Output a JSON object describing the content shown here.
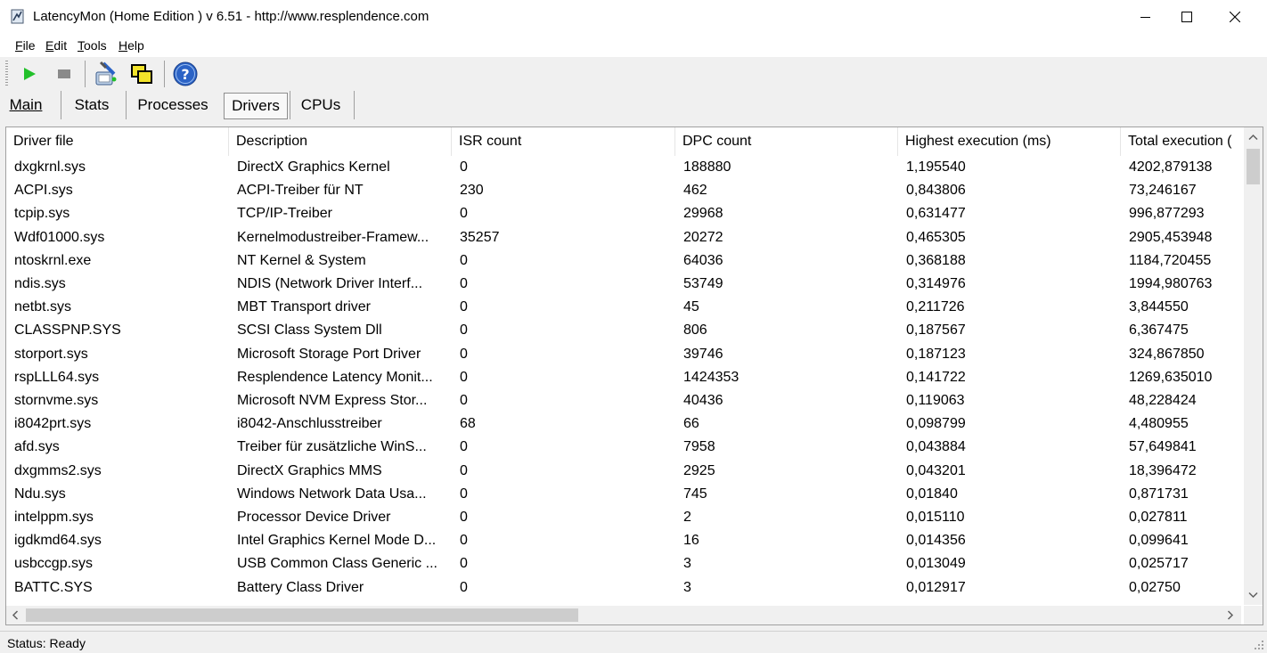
{
  "window": {
    "title": "LatencyMon  (Home Edition )  v 6.51 - http://www.resplendence.com"
  },
  "menu": [
    {
      "key": "F",
      "rest": "ile"
    },
    {
      "key": "E",
      "rest": "dit"
    },
    {
      "key": "T",
      "rest": "ools"
    },
    {
      "key": "H",
      "rest": "elp"
    }
  ],
  "toolbar": {
    "icons": [
      "start-play-icon",
      "stop-icon",
      "analyze-tools-icon",
      "copy-windows-icon",
      "help-question-icon"
    ],
    "colors": {
      "play": "#22c02a",
      "help": "#2b63c6"
    }
  },
  "tabs": [
    {
      "label": "Main",
      "active": false
    },
    {
      "label": "Stats",
      "active": false
    },
    {
      "label": "Processes",
      "active": false
    },
    {
      "label": "Drivers",
      "active": true
    },
    {
      "label": "CPUs",
      "active": false
    }
  ],
  "table": {
    "columns": [
      "Driver file",
      "Description",
      "ISR count",
      "DPC count",
      "Highest execution (ms)",
      "Total execution ("
    ],
    "rows": [
      [
        "dxgkrnl.sys",
        "DirectX Graphics Kernel",
        "0",
        "188880",
        "1,195540",
        "4202,879138"
      ],
      [
        "ACPI.sys",
        "ACPI-Treiber für NT",
        "230",
        "462",
        "0,843806",
        "73,246167"
      ],
      [
        "tcpip.sys",
        "TCP/IP-Treiber",
        "0",
        "29968",
        "0,631477",
        "996,877293"
      ],
      [
        "Wdf01000.sys",
        "Kernelmodustreiber-Framew...",
        "35257",
        "20272",
        "0,465305",
        "2905,453948"
      ],
      [
        "ntoskrnl.exe",
        "NT Kernel & System",
        "0",
        "64036",
        "0,368188",
        "1184,720455"
      ],
      [
        "ndis.sys",
        "NDIS (Network Driver Interf...",
        "0",
        "53749",
        "0,314976",
        "1994,980763"
      ],
      [
        "netbt.sys",
        "MBT Transport driver",
        "0",
        "45",
        "0,211726",
        "3,844550"
      ],
      [
        "CLASSPNP.SYS",
        "SCSI Class System Dll",
        "0",
        "806",
        "0,187567",
        "6,367475"
      ],
      [
        "storport.sys",
        "Microsoft Storage Port Driver",
        "0",
        "39746",
        "0,187123",
        "324,867850"
      ],
      [
        "rspLLL64.sys",
        "Resplendence Latency Monit...",
        "0",
        "1424353",
        "0,141722",
        "1269,635010"
      ],
      [
        "stornvme.sys",
        "Microsoft NVM Express Stor...",
        "0",
        "40436",
        "0,119063",
        "48,228424"
      ],
      [
        "i8042prt.sys",
        "i8042-Anschlusstreiber",
        "68",
        "66",
        "0,098799",
        "4,480955"
      ],
      [
        "afd.sys",
        "Treiber für zusätzliche WinS...",
        "0",
        "7958",
        "0,043884",
        "57,649841"
      ],
      [
        "dxgmms2.sys",
        "DirectX Graphics MMS",
        "0",
        "2925",
        "0,043201",
        "18,396472"
      ],
      [
        "Ndu.sys",
        "Windows Network Data Usa...",
        "0",
        "745",
        "0,01840",
        "0,871731"
      ],
      [
        "intelppm.sys",
        "Processor Device Driver",
        "0",
        "2",
        "0,015110",
        "0,027811"
      ],
      [
        "igdkmd64.sys",
        "Intel Graphics Kernel Mode D...",
        "0",
        "16",
        "0,014356",
        "0,099641"
      ],
      [
        "usbccgp.sys",
        "USB Common Class Generic ...",
        "0",
        "3",
        "0,013049",
        "0,025717"
      ],
      [
        "BATTC.SYS",
        "Battery Class Driver",
        "0",
        "3",
        "0,012917",
        "0,02750"
      ]
    ]
  },
  "status": {
    "text": "Status: Ready"
  }
}
